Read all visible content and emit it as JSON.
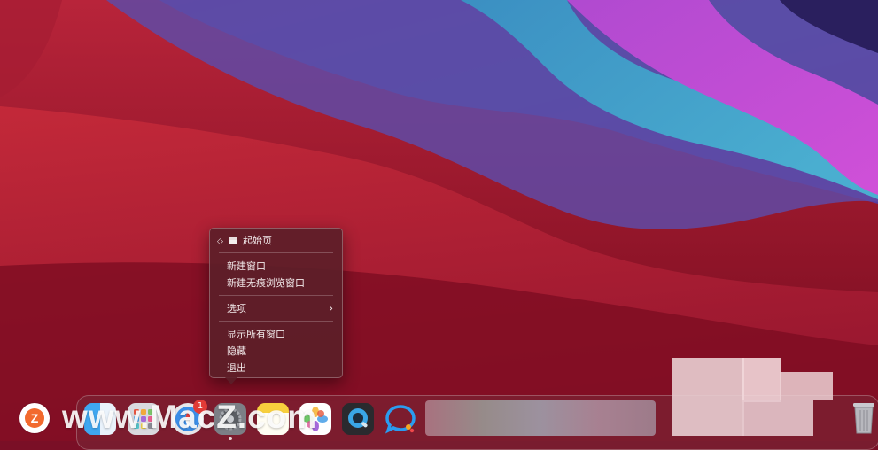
{
  "context_menu": {
    "tab_title": "起始页",
    "new_window": "新建窗口",
    "new_private_window": "新建无痕浏览窗口",
    "options": "选项",
    "show_all_windows": "显示所有窗口",
    "hide": "隐藏",
    "quit": "退出"
  },
  "dock": {
    "icons": [
      "finder-icon",
      "launchpad-icon",
      "safari-icon",
      "system-preferences-icon",
      "notes-icon",
      "photos-icon",
      "quicktime-icon",
      "chat-app-icon",
      "trash-icon"
    ],
    "badge_count": "1"
  },
  "watermark": {
    "logo_letter": "Z",
    "text": "www.MacZ.com"
  },
  "colors": {
    "wallpaper_red": "#b3202f",
    "wallpaper_purple": "#6a3fa0",
    "wallpaper_cyan": "#3aa0c4",
    "menu_bg": "#5c1e28",
    "badge": "#e23a36"
  }
}
